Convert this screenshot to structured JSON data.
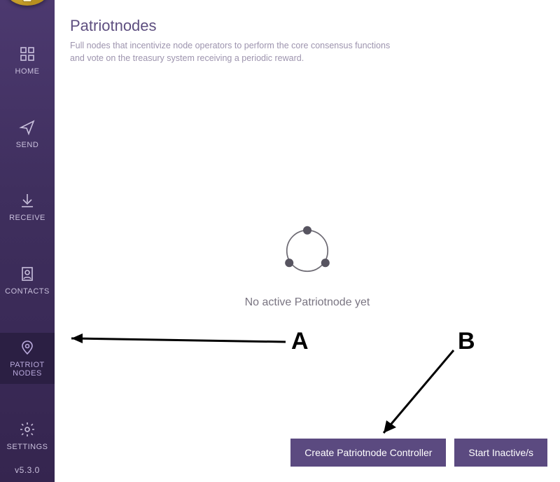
{
  "sidebar": {
    "items": [
      {
        "label": "HOME"
      },
      {
        "label": "SEND"
      },
      {
        "label": "RECEIVE"
      },
      {
        "label": "CONTACTS"
      },
      {
        "label": "PATRIOT\nNODES"
      },
      {
        "label": "SETTINGS"
      }
    ],
    "version": "v5.3.0"
  },
  "page": {
    "title": "Patriotnodes",
    "subtitle": "Full nodes that incentivize node operators to perform the core consensus functions and vote on the treasury system receiving a periodic reward."
  },
  "empty_state": {
    "text": "No active Patriotnode yet"
  },
  "buttons": {
    "create": "Create Patriotnode Controller",
    "start_inactive": "Start Inactive/s"
  },
  "annotations": {
    "a": "A",
    "b": "B"
  }
}
